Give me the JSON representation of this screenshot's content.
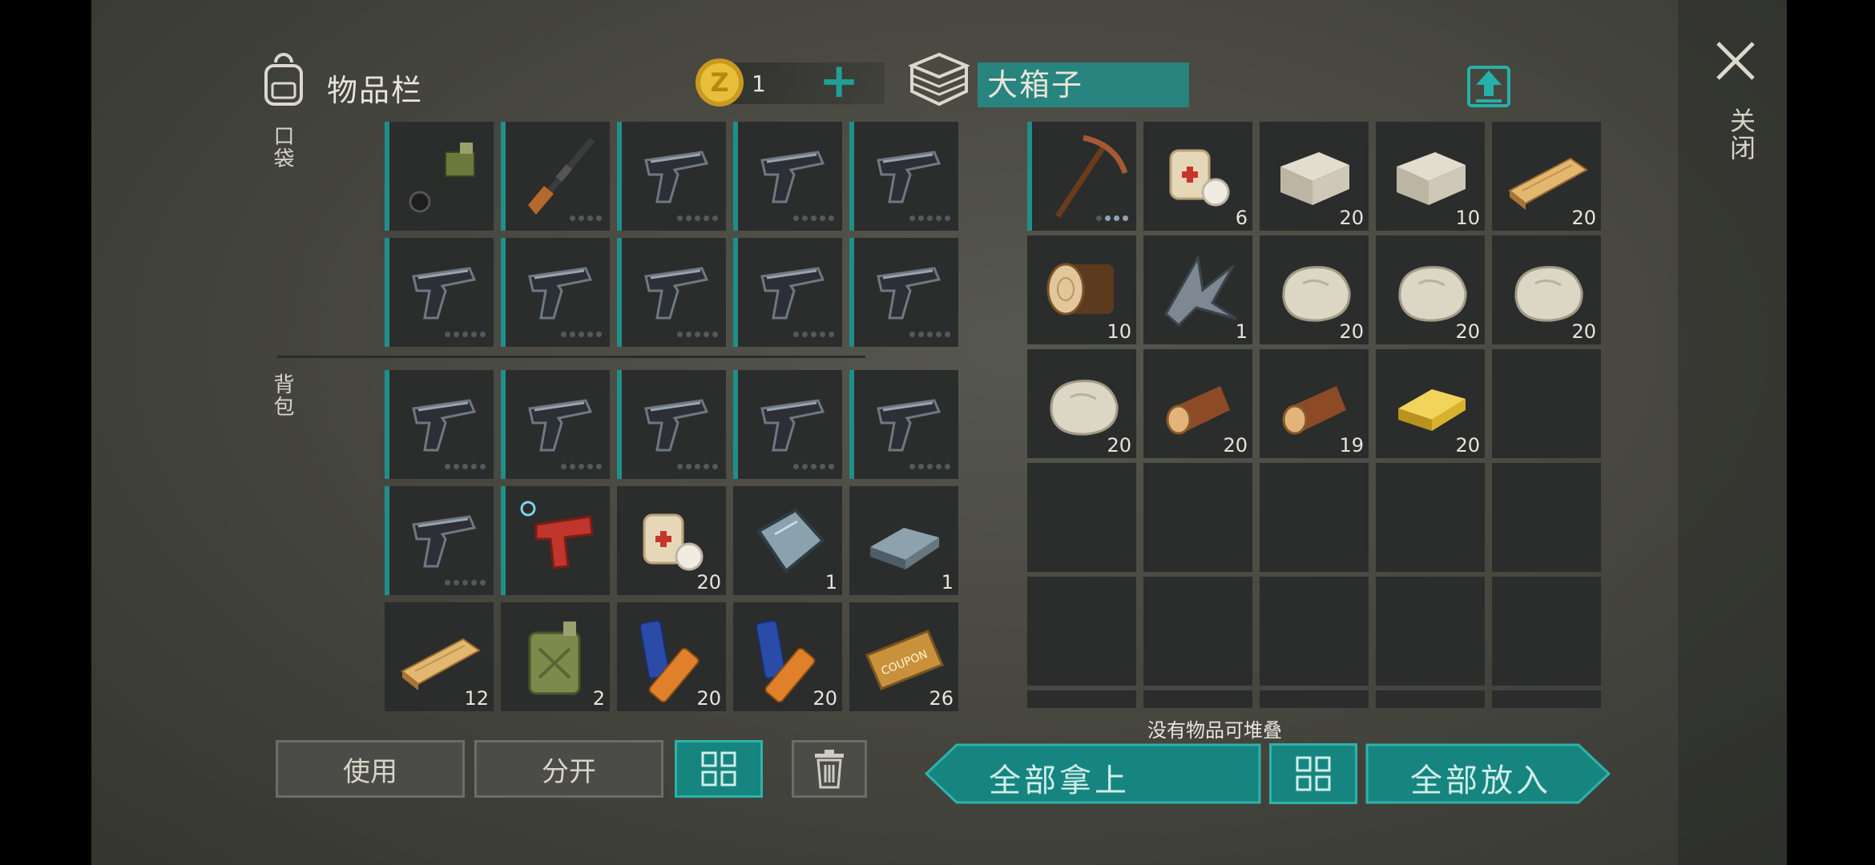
{
  "inventory": {
    "title": "物品栏",
    "coins": "1",
    "add_label": "+",
    "pocket_label": "口袋",
    "backpack_label": "背包",
    "pocket_items": [
      {
        "icon": "flamethrower-icon",
        "count": "",
        "dots": 0
      },
      {
        "icon": "rifle-icon",
        "count": "",
        "dots": 4
      },
      {
        "icon": "pistol-icon",
        "count": "",
        "dots": 5
      },
      {
        "icon": "pistol-icon",
        "count": "",
        "dots": 5
      },
      {
        "icon": "pistol-icon",
        "count": "",
        "dots": 5
      },
      {
        "icon": "pistol-icon",
        "count": "",
        "dots": 5
      },
      {
        "icon": "pistol-icon",
        "count": "",
        "dots": 5
      },
      {
        "icon": "pistol-icon",
        "count": "",
        "dots": 5
      },
      {
        "icon": "pistol-icon",
        "count": "",
        "dots": 5
      },
      {
        "icon": "pistol-icon",
        "count": "",
        "dots": 5
      }
    ],
    "backpack_items": [
      {
        "icon": "pistol-icon",
        "count": "",
        "dots": 5
      },
      {
        "icon": "pistol-icon",
        "count": "",
        "dots": 5
      },
      {
        "icon": "pistol-icon",
        "count": "",
        "dots": 5
      },
      {
        "icon": "pistol-icon",
        "count": "",
        "dots": 5
      },
      {
        "icon": "pistol-icon",
        "count": "",
        "dots": 5
      },
      {
        "icon": "pistol-icon",
        "count": "",
        "dots": 5
      },
      {
        "icon": "flare-gun-icon",
        "count": "",
        "dots": 0
      },
      {
        "icon": "bandage-icon",
        "count": "20",
        "dots": 0
      },
      {
        "icon": "glass-plate-icon",
        "count": "1",
        "dots": 0
      },
      {
        "icon": "iron-ingot-icon",
        "count": "1",
        "dots": 0
      },
      {
        "icon": "plank-icon",
        "count": "12",
        "dots": 0
      },
      {
        "icon": "jerrycan-icon",
        "count": "2",
        "dots": 0
      },
      {
        "icon": "battery-icon",
        "count": "20",
        "dots": 0
      },
      {
        "icon": "battery-icon",
        "count": "20",
        "dots": 0
      },
      {
        "icon": "coupon-icon",
        "count": "26",
        "dots": 0
      }
    ],
    "use_label": "使用",
    "split_label": "分开"
  },
  "box": {
    "title": "大箱子",
    "items": [
      {
        "icon": "pickaxe-icon",
        "count": "",
        "dots": 4
      },
      {
        "icon": "bandage-icon",
        "count": "6",
        "dots": 0
      },
      {
        "icon": "stone-block-icon",
        "count": "20",
        "dots": 0
      },
      {
        "icon": "stone-block-icon",
        "count": "10",
        "dots": 0
      },
      {
        "icon": "plank-icon",
        "count": "20",
        "dots": 0
      },
      {
        "icon": "log-icon",
        "count": "10",
        "dots": 0
      },
      {
        "icon": "scrap-metal-icon",
        "count": "1",
        "dots": 0
      },
      {
        "icon": "stone-icon",
        "count": "20",
        "dots": 0
      },
      {
        "icon": "stone-icon",
        "count": "20",
        "dots": 0
      },
      {
        "icon": "stone-icon",
        "count": "20",
        "dots": 0
      },
      {
        "icon": "stone-icon",
        "count": "20",
        "dots": 0
      },
      {
        "icon": "wood-log-icon",
        "count": "20",
        "dots": 0
      },
      {
        "icon": "wood-log-icon",
        "count": "19",
        "dots": 0
      },
      {
        "icon": "gold-ingot-icon",
        "count": "20",
        "dots": 0
      }
    ],
    "status": "没有物品可堆叠",
    "take_all_label": "全部拿上",
    "put_all_label": "全部放入"
  },
  "close_label": "关闭"
}
